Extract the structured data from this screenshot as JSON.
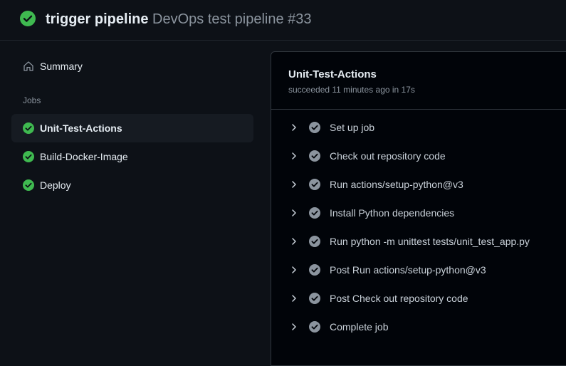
{
  "header": {
    "workflow": "trigger pipeline",
    "run_title": "DevOps test pipeline #33",
    "status_icon": "check-circle-fill-icon",
    "status_color": "#3fb950"
  },
  "sidebar": {
    "summary_label": "Summary",
    "summary_icon": "home-icon",
    "jobs_heading": "Jobs",
    "jobs": [
      {
        "label": "Unit-Test-Actions",
        "status": "success",
        "active": true
      },
      {
        "label": "Build-Docker-Image",
        "status": "success",
        "active": false
      },
      {
        "label": "Deploy",
        "status": "success",
        "active": false
      }
    ]
  },
  "job_panel": {
    "title": "Unit-Test-Actions",
    "subtitle": "succeeded 11 minutes ago in 17s",
    "steps": [
      {
        "label": "Set up job"
      },
      {
        "label": "Check out repository code"
      },
      {
        "label": "Run actions/setup-python@v3"
      },
      {
        "label": "Install Python dependencies"
      },
      {
        "label": "Run python -m unittest tests/unit_test_app.py"
      },
      {
        "label": "Post Run actions/setup-python@v3"
      },
      {
        "label": "Post Check out repository code"
      },
      {
        "label": "Complete job"
      }
    ],
    "step_status_color": "#8b949e"
  },
  "colors": {
    "background": "#0d1117",
    "panel_background": "#010409",
    "success": "#3fb950",
    "muted": "#8b949e"
  }
}
